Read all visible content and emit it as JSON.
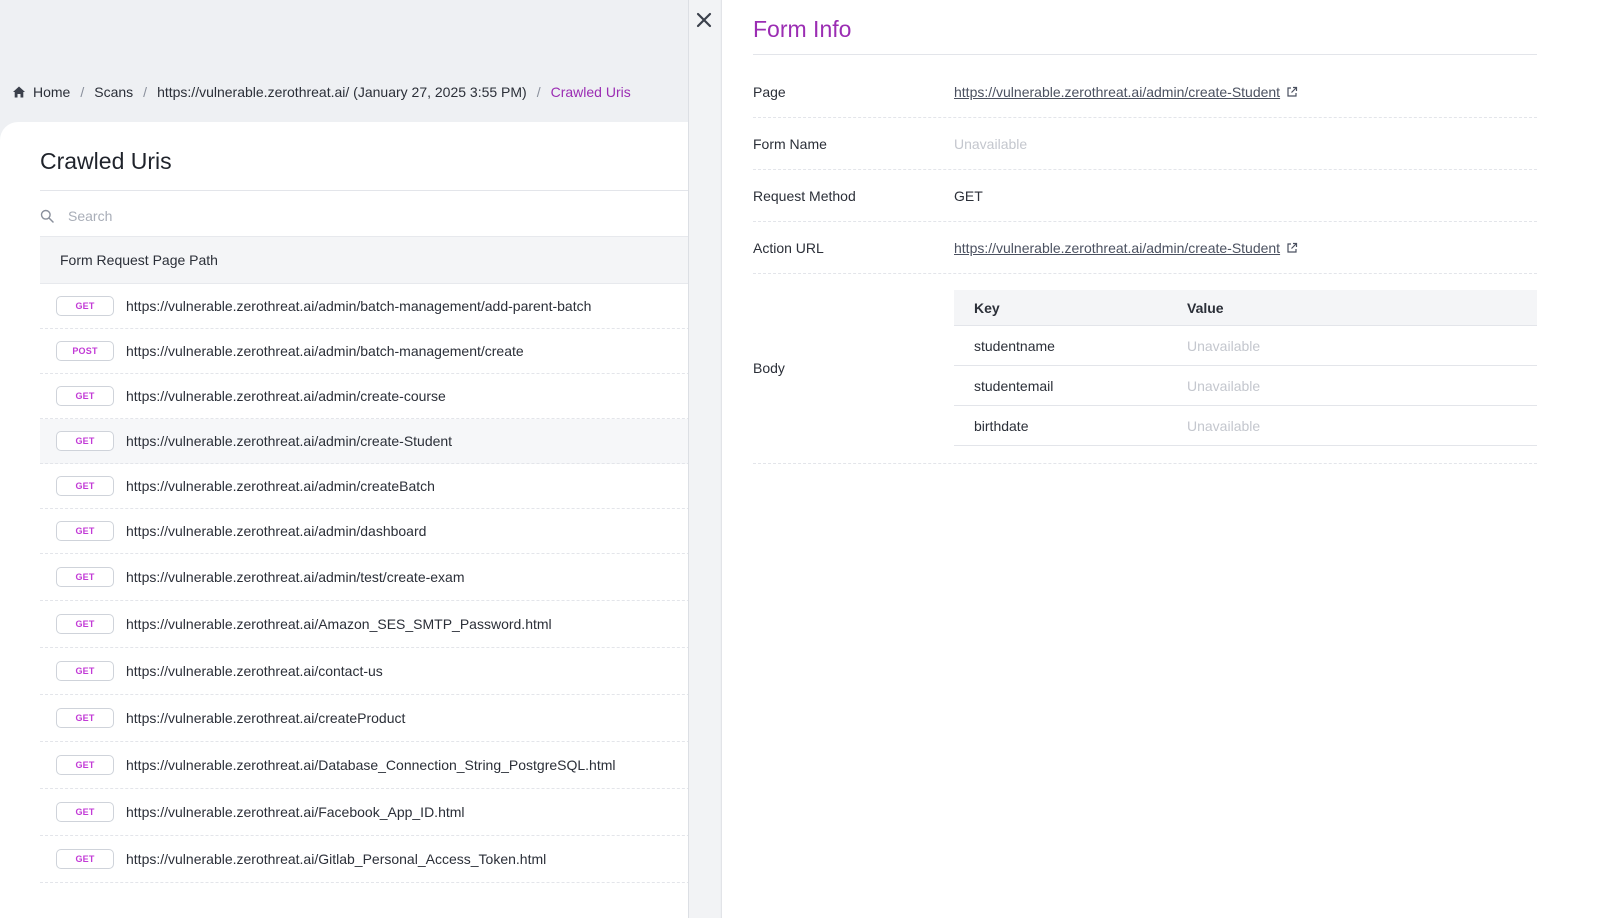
{
  "breadcrumb": {
    "home": "Home",
    "scans": "Scans",
    "scan": "https://vulnerable.zerothreat.ai/ (January 27, 2025 3:55 PM)",
    "current": "Crawled Uris",
    "separator": "/"
  },
  "main": {
    "title": "Crawled Uris",
    "search_placeholder": "Search",
    "column_header": "Form Request Page Path",
    "rows": [
      {
        "method": "GET",
        "url": "https://vulnerable.zerothreat.ai/admin/batch-management/add-parent-batch"
      },
      {
        "method": "POST",
        "url": "https://vulnerable.zerothreat.ai/admin/batch-management/create"
      },
      {
        "method": "GET",
        "url": "https://vulnerable.zerothreat.ai/admin/create-course"
      },
      {
        "method": "GET",
        "url": "https://vulnerable.zerothreat.ai/admin/create-Student"
      },
      {
        "method": "GET",
        "url": "https://vulnerable.zerothreat.ai/admin/createBatch"
      },
      {
        "method": "GET",
        "url": "https://vulnerable.zerothreat.ai/admin/dashboard"
      },
      {
        "method": "GET",
        "url": "https://vulnerable.zerothreat.ai/admin/test/create-exam"
      },
      {
        "method": "GET",
        "url": "https://vulnerable.zerothreat.ai/Amazon_SES_SMTP_Password.html"
      },
      {
        "method": "GET",
        "url": "https://vulnerable.zerothreat.ai/contact-us"
      },
      {
        "method": "GET",
        "url": "https://vulnerable.zerothreat.ai/createProduct"
      },
      {
        "method": "GET",
        "url": "https://vulnerable.zerothreat.ai/Database_Connection_String_PostgreSQL.html"
      },
      {
        "method": "GET",
        "url": "https://vulnerable.zerothreat.ai/Facebook_App_ID.html"
      },
      {
        "method": "GET",
        "url": "https://vulnerable.zerothreat.ai/Gitlab_Personal_Access_Token.html"
      }
    ]
  },
  "drawer": {
    "title": "Form Info",
    "page_label": "Page",
    "page_value": "https://vulnerable.zerothreat.ai/admin/create-Student",
    "form_name_label": "Form Name",
    "form_name_value": "Unavailable",
    "method_label": "Request Method",
    "method_value": "GET",
    "action_label": "Action URL",
    "action_value": "https://vulnerable.zerothreat.ai/admin/create-Student",
    "body_label": "Body",
    "body_table": {
      "key_header": "Key",
      "value_header": "Value",
      "rows": [
        {
          "key": "studentname",
          "value": "Unavailable"
        },
        {
          "key": "studentemail",
          "value": "Unavailable"
        },
        {
          "key": "birthdate",
          "value": "Unavailable"
        }
      ]
    }
  },
  "icons": {
    "home": "home-icon",
    "search": "search-icon",
    "close": "close-icon",
    "external": "external-link-icon"
  },
  "colors": {
    "accent": "#9b2db3",
    "badge_text": "#c23ad6",
    "muted": "#c4c7ce"
  }
}
